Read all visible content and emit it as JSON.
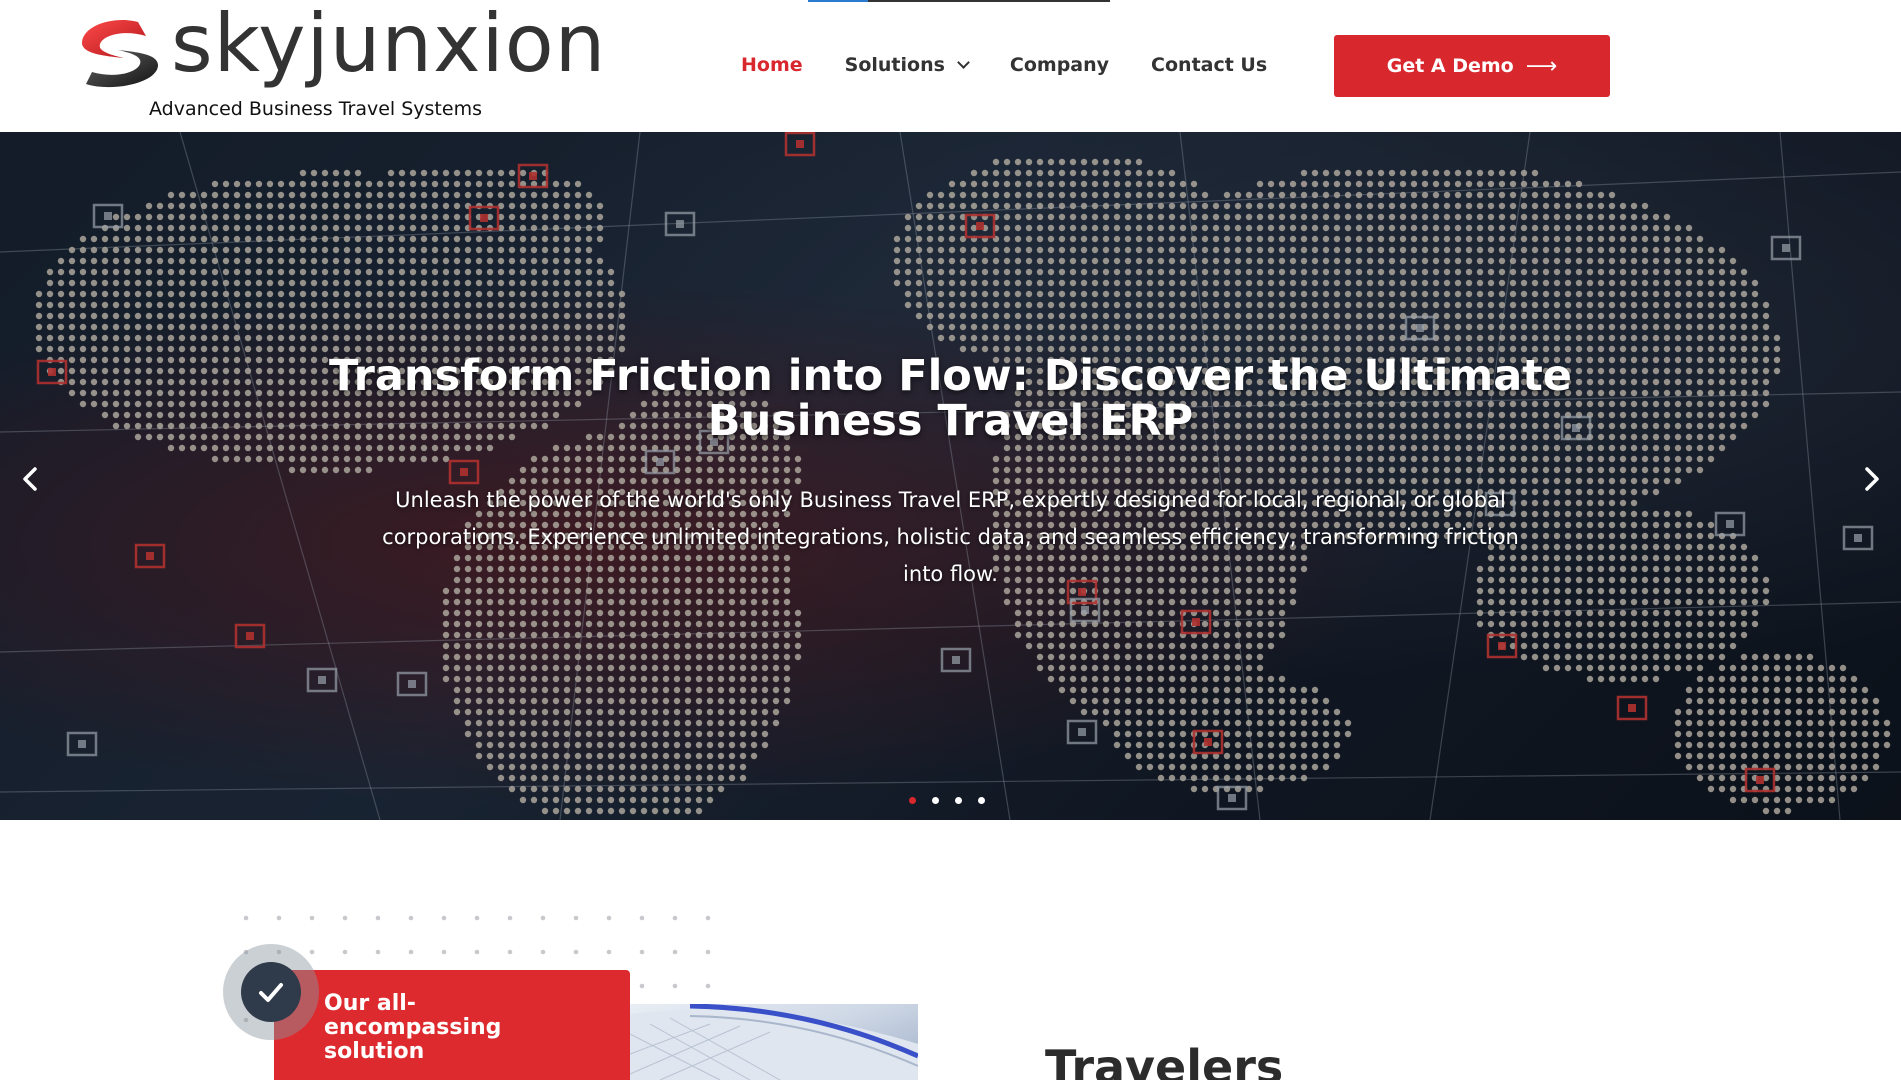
{
  "brand": {
    "name": "skyjunxion",
    "tagline": "Advanced Business Travel Systems",
    "colors": {
      "accent": "#d9272e",
      "dark": "#333333"
    }
  },
  "nav": {
    "items": [
      {
        "label": "Home",
        "active": true
      },
      {
        "label": "Solutions",
        "active": false,
        "has_dropdown": true
      },
      {
        "label": "Company",
        "active": false
      },
      {
        "label": "Contact Us",
        "active": false
      }
    ],
    "cta_label": "Get A Demo",
    "cta_icon": "arrow-right-icon"
  },
  "hero": {
    "title": "Transform Friction into Flow: Discover the Ultimate Business Travel ERP",
    "description": "Unleash the power of the world's only Business Travel ERP, expertly designed for local, regional, or global corporations. Experience unlimited integrations, holistic data, and seamless efficiency, transforming friction into flow.",
    "prev_icon": "chevron-left-icon",
    "next_icon": "chevron-right-icon",
    "slides": {
      "count": 4,
      "active_index": 0
    }
  },
  "feature": {
    "badge_icon": "check-icon",
    "card_text": "Our all-encompassing solution",
    "section_heading": "Travelers"
  }
}
